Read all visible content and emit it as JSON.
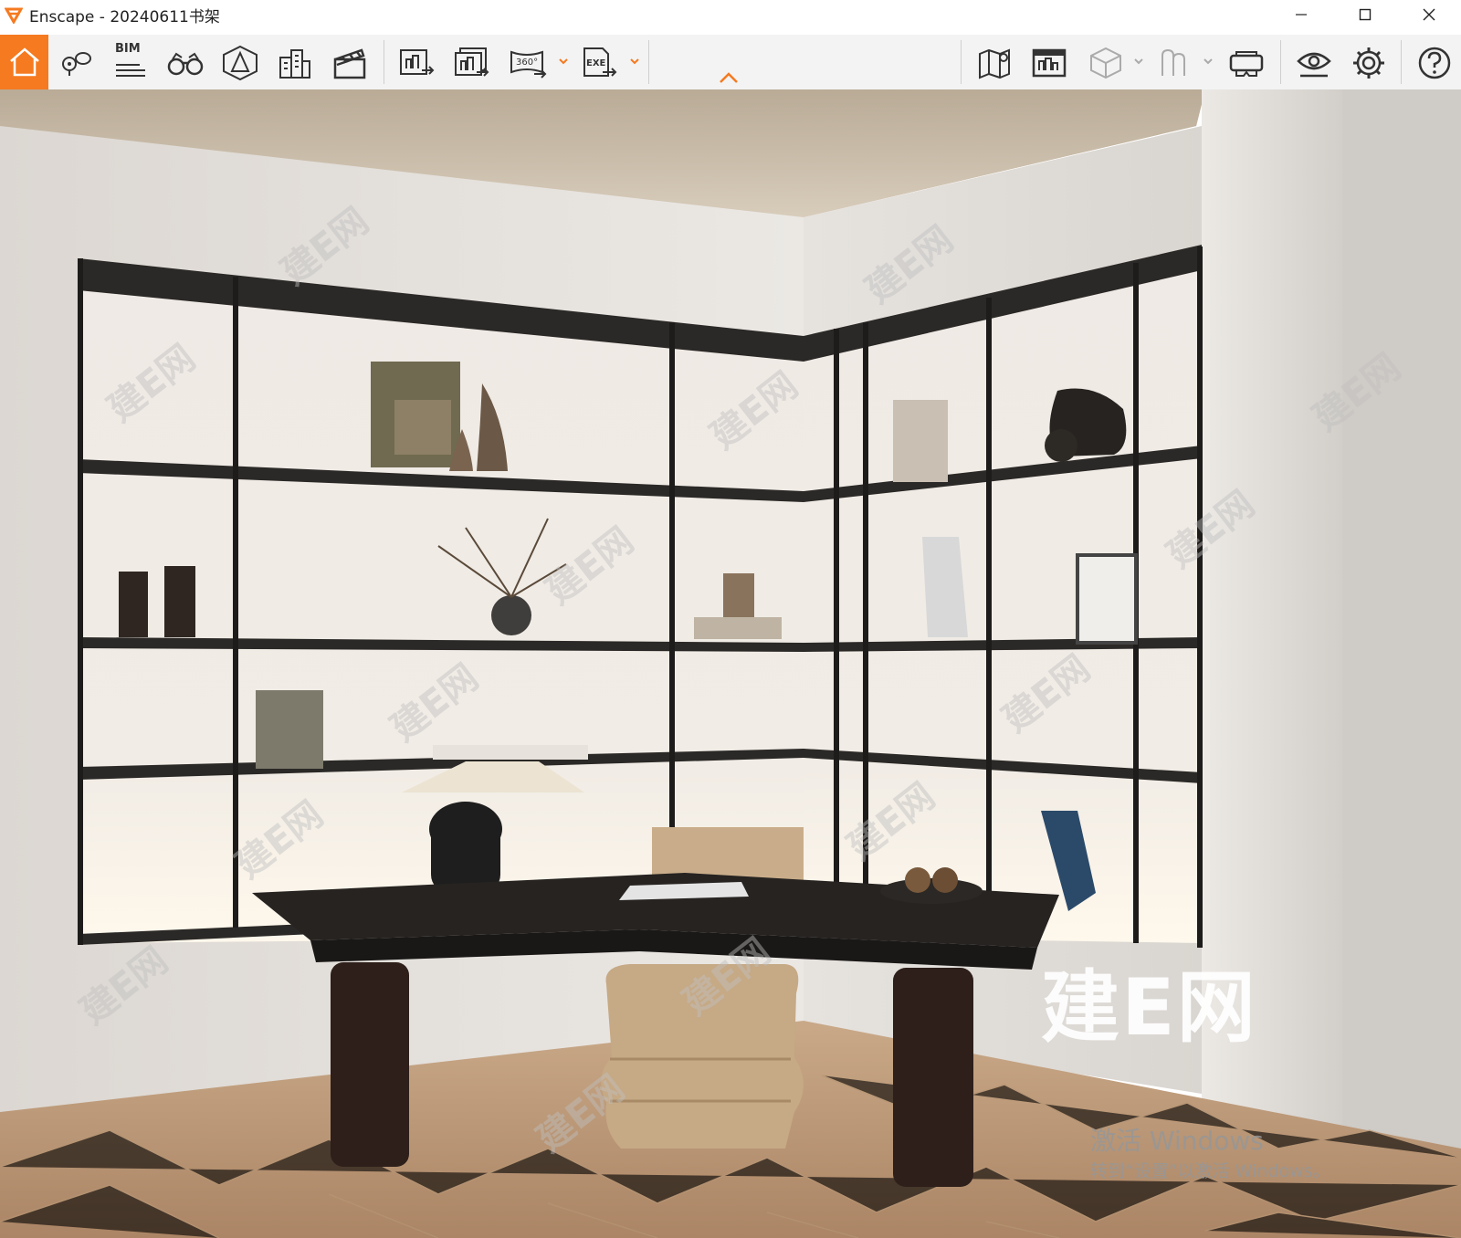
{
  "window": {
    "app_name": "Enscape",
    "separator": " - ",
    "project_name": "20240611书架",
    "controls": [
      "minimize",
      "maximize",
      "close"
    ]
  },
  "toolbar": {
    "accent_color": "#f57a20",
    "bim_label": "BIM",
    "panorama_label": "360°",
    "exe_label": "EXE",
    "icons": [
      "home-icon",
      "views-icon",
      "bim-icon",
      "binoculars-icon",
      "perspective-icon",
      "buildings-icon",
      "clapper-icon",
      "render-screenshot-icon",
      "batch-render-icon",
      "render-360-icon",
      "export-exe-icon",
      "map-icon",
      "asset-library-icon",
      "material-editor-icon",
      "atmosphere-icon",
      "vr-headset-icon",
      "visual-settings-icon",
      "gear-icon",
      "help-icon"
    ]
  },
  "viewport": {
    "scene": "3D rendered study room with corner black metal shelving, desk, lamp and chair",
    "watermark_text": "建E网",
    "watermark_small": "建E网",
    "activation_title": "激活 Windows",
    "activation_subtitle": "转到“设置”以激活 Windows。"
  }
}
